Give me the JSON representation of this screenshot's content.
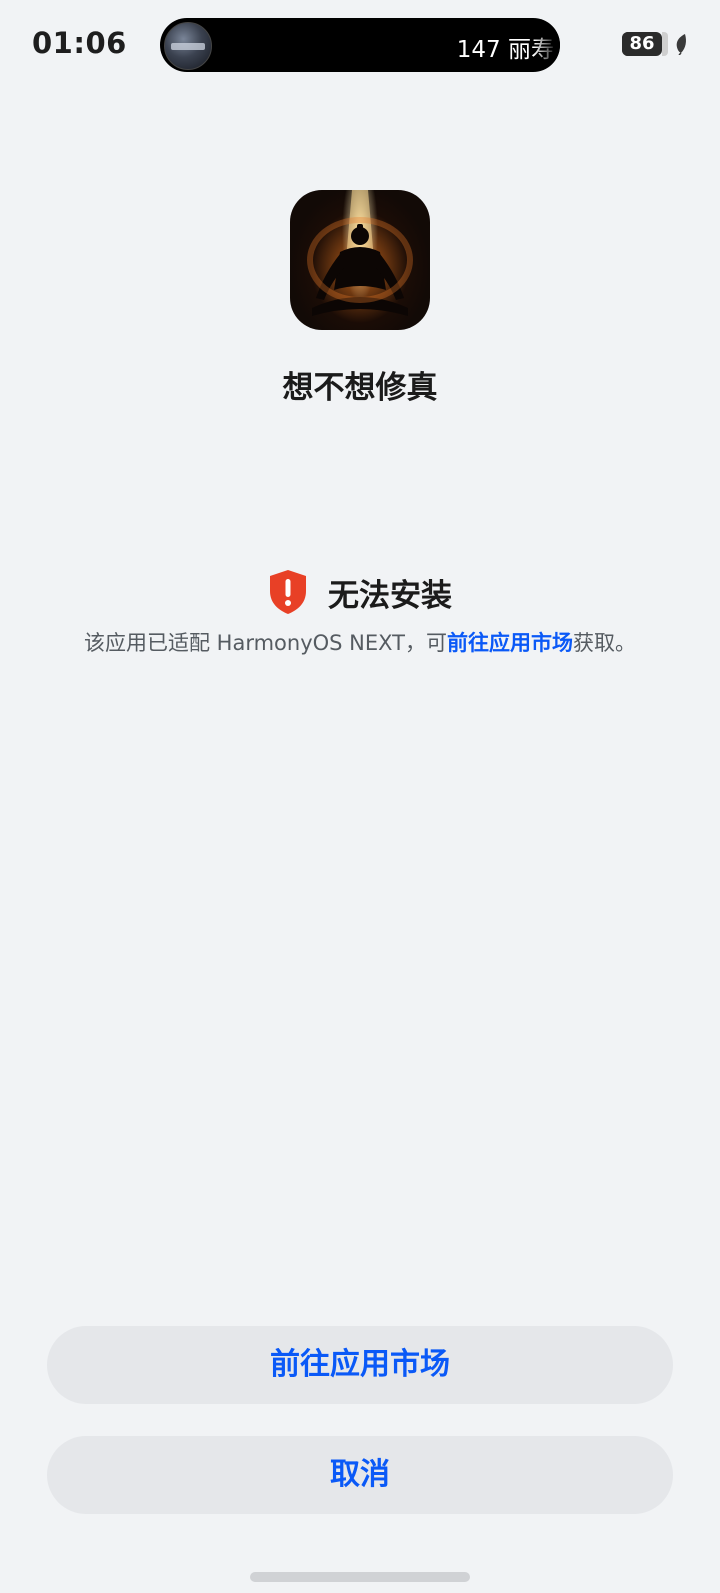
{
  "status_bar": {
    "time": "01:06",
    "live_activity_text": "147 丽寿",
    "battery_percent": 86,
    "battery_label": "86"
  },
  "app": {
    "name": "想不想修真"
  },
  "install_status": {
    "title": "无法安装",
    "message_prefix": "该应用已适配 HarmonyOS NEXT，可",
    "message_link": "前往应用市场",
    "message_suffix": "获取。"
  },
  "actions": {
    "market_label": "前往应用市场",
    "cancel_label": "取消"
  },
  "colors": {
    "accent": "#0a59f7",
    "warning": "#e84026",
    "background": "#f1f3f5",
    "button_bg": "#e5e7ea"
  },
  "icons": {
    "warning": "shield-exclamation-icon",
    "battery": "battery-icon",
    "eco": "leaf-icon"
  }
}
